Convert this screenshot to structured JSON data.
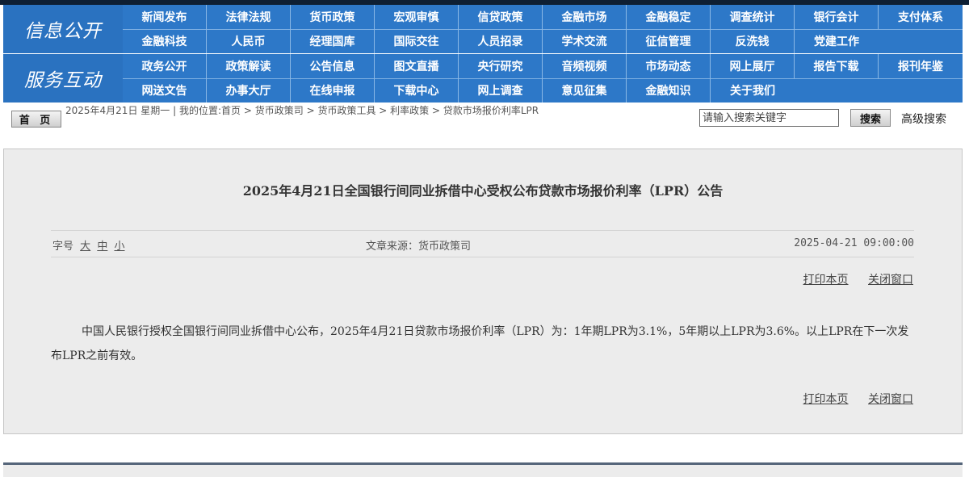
{
  "nav": {
    "info_logo": "信息公开",
    "service_logo": "服务互动",
    "info_row1": [
      "新闻发布",
      "法律法规",
      "货币政策",
      "宏观审慎",
      "信贷政策",
      "金融市场",
      "金融稳定",
      "调查统计",
      "银行会计",
      "支付体系"
    ],
    "info_row2": [
      "金融科技",
      "人民币",
      "经理国库",
      "国际交往",
      "人员招录",
      "学术交流",
      "征信管理",
      "反洗钱",
      "党建工作"
    ],
    "service_row1": [
      "政务公开",
      "政策解读",
      "公告信息",
      "图文直播",
      "央行研究",
      "音频视频",
      "市场动态",
      "网上展厅",
      "报告下载",
      "报刊年鉴"
    ],
    "service_row2": [
      "网送文告",
      "办事大厅",
      "在线申报",
      "下载中心",
      "网上调查",
      "意见征集",
      "金融知识",
      "关于我们"
    ]
  },
  "breadcrumb": {
    "home": "首 页",
    "date": "2025年4月21日 星期一",
    "location_label": "我的位置:",
    "items": [
      "首页",
      "货币政策司",
      "货币政策工具",
      "利率政策",
      "贷款市场报价利率LPR"
    ]
  },
  "search": {
    "placeholder": "请输入搜索关键字",
    "button": "搜索",
    "advanced": "高级搜索"
  },
  "article": {
    "title": "2025年4月21日全国银行间同业拆借中心受权公布贷款市场报价利率（LPR）公告",
    "font_size_label": "字号",
    "font_large": "大",
    "font_medium": "中",
    "font_small": "小",
    "source": "文章来源：货币政策司",
    "publish_time": "2025-04-21 09:00:00",
    "print": "打印本页",
    "close": "关闭窗口",
    "body": "中国人民银行授权全国银行间同业拆借中心公布，2025年4月21日贷款市场报价利率（LPR）为：1年期LPR为3.1%，5年期以上LPR为3.6%。以上LPR在下一次发布LPR之前有效。"
  }
}
